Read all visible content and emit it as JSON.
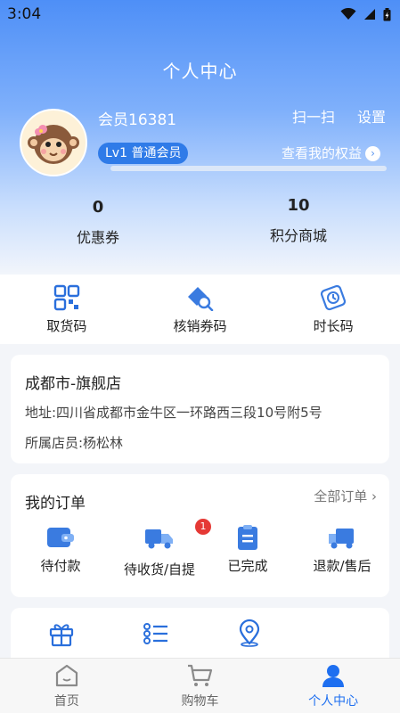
{
  "status_bar": {
    "time": "3:04"
  },
  "header": {
    "title": "个人中心"
  },
  "profile": {
    "member_name": "会员16381",
    "scan_label": "扫一扫",
    "settings_label": "设置",
    "level_badge": "Lv1 普通会员",
    "rights_link": "查看我的权益",
    "level_progress": 0.0
  },
  "stats": [
    {
      "value": "0",
      "label": "优惠券"
    },
    {
      "value": "10",
      "label": "积分商城"
    }
  ],
  "quick_actions": [
    {
      "label": "取货码",
      "icon": "qrcode-icon"
    },
    {
      "label": "核销券码",
      "icon": "coupon-scan-icon"
    },
    {
      "label": "时长码",
      "icon": "timer-icon"
    }
  ],
  "store": {
    "name": "成都市-旗舰店",
    "address": "地址:四川省成都市金牛区一环路西三段10号附5号",
    "clerk": "所属店员:杨松林"
  },
  "orders": {
    "title": "我的订单",
    "all_label": "全部订单",
    "items": [
      {
        "label": "待付款",
        "icon": "wallet-icon",
        "badge": ""
      },
      {
        "label": "待收货/自提",
        "icon": "delivery-truck-icon",
        "badge": "1"
      },
      {
        "label": "已完成",
        "icon": "clipboard-icon",
        "badge": ""
      },
      {
        "label": "退款/售后",
        "icon": "return-truck-icon",
        "badge": ""
      }
    ]
  },
  "more_icons": [
    "gift-icon",
    "list-icon",
    "location-pin-icon"
  ],
  "tabbar": {
    "tabs": [
      {
        "label": "首页",
        "icon": "home-icon",
        "active": false
      },
      {
        "label": "购物车",
        "icon": "cart-icon",
        "active": false
      },
      {
        "label": "个人中心",
        "icon": "user-icon",
        "active": true
      }
    ]
  },
  "colors": {
    "accent": "#1e6ff0",
    "badge": "#e53935",
    "hero_top": "#4e8ff7"
  }
}
